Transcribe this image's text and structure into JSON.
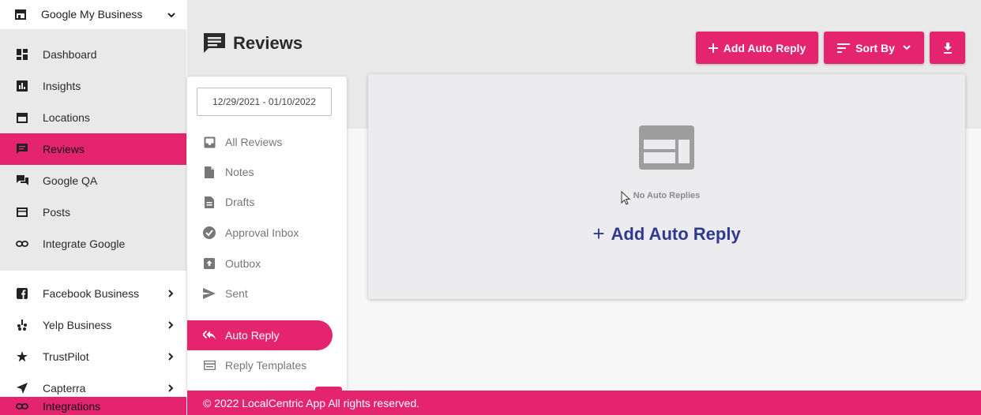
{
  "sidebar": {
    "header": {
      "label": "Google My Business",
      "icon": "store-icon"
    },
    "items": [
      {
        "label": "Dashboard",
        "icon": "dashboard-icon"
      },
      {
        "label": "Insights",
        "icon": "bar-chart-icon"
      },
      {
        "label": "Locations",
        "icon": "storefront-icon"
      },
      {
        "label": "Reviews",
        "icon": "comment-icon",
        "active": true
      },
      {
        "label": "Google QA",
        "icon": "forum-icon"
      },
      {
        "label": "Posts",
        "icon": "post-icon"
      },
      {
        "label": "Integrate Google",
        "icon": "link-icon"
      }
    ],
    "other": [
      {
        "label": "Facebook Business",
        "icon": "facebook-icon"
      },
      {
        "label": "Yelp Business",
        "icon": "yelp-icon"
      },
      {
        "label": "TrustPilot",
        "icon": "star-icon"
      },
      {
        "label": "Capterra",
        "icon": "navigation-icon"
      }
    ],
    "integrations": {
      "label": "Integrations",
      "icon": "link-icon"
    }
  },
  "page": {
    "title": "Reviews"
  },
  "toolbar": {
    "add_auto_reply": "Add Auto Reply",
    "sort_by": "Sort By"
  },
  "filters": {
    "date_range": "12/29/2021 - 01/10/2022",
    "items": [
      {
        "label": "All Reviews",
        "icon": "inbox-icon"
      },
      {
        "label": "Notes",
        "icon": "note-icon"
      },
      {
        "label": "Drafts",
        "icon": "draft-icon"
      },
      {
        "label": "Approval Inbox",
        "icon": "check-circle-icon"
      },
      {
        "label": "Outbox",
        "icon": "outbox-icon"
      },
      {
        "label": "Sent",
        "icon": "send-icon"
      },
      {
        "label": "Auto Reply",
        "icon": "reply-all-icon",
        "active": true
      },
      {
        "label": "Reply Templates",
        "icon": "template-icon"
      }
    ]
  },
  "main": {
    "empty_text": "No Auto Replies",
    "add_link": "Add Auto Reply"
  },
  "footer": {
    "text": "© 2022 LocalCentric App All rights reserved."
  },
  "colors": {
    "accent": "#e5246f",
    "link": "#2f3a8f"
  }
}
